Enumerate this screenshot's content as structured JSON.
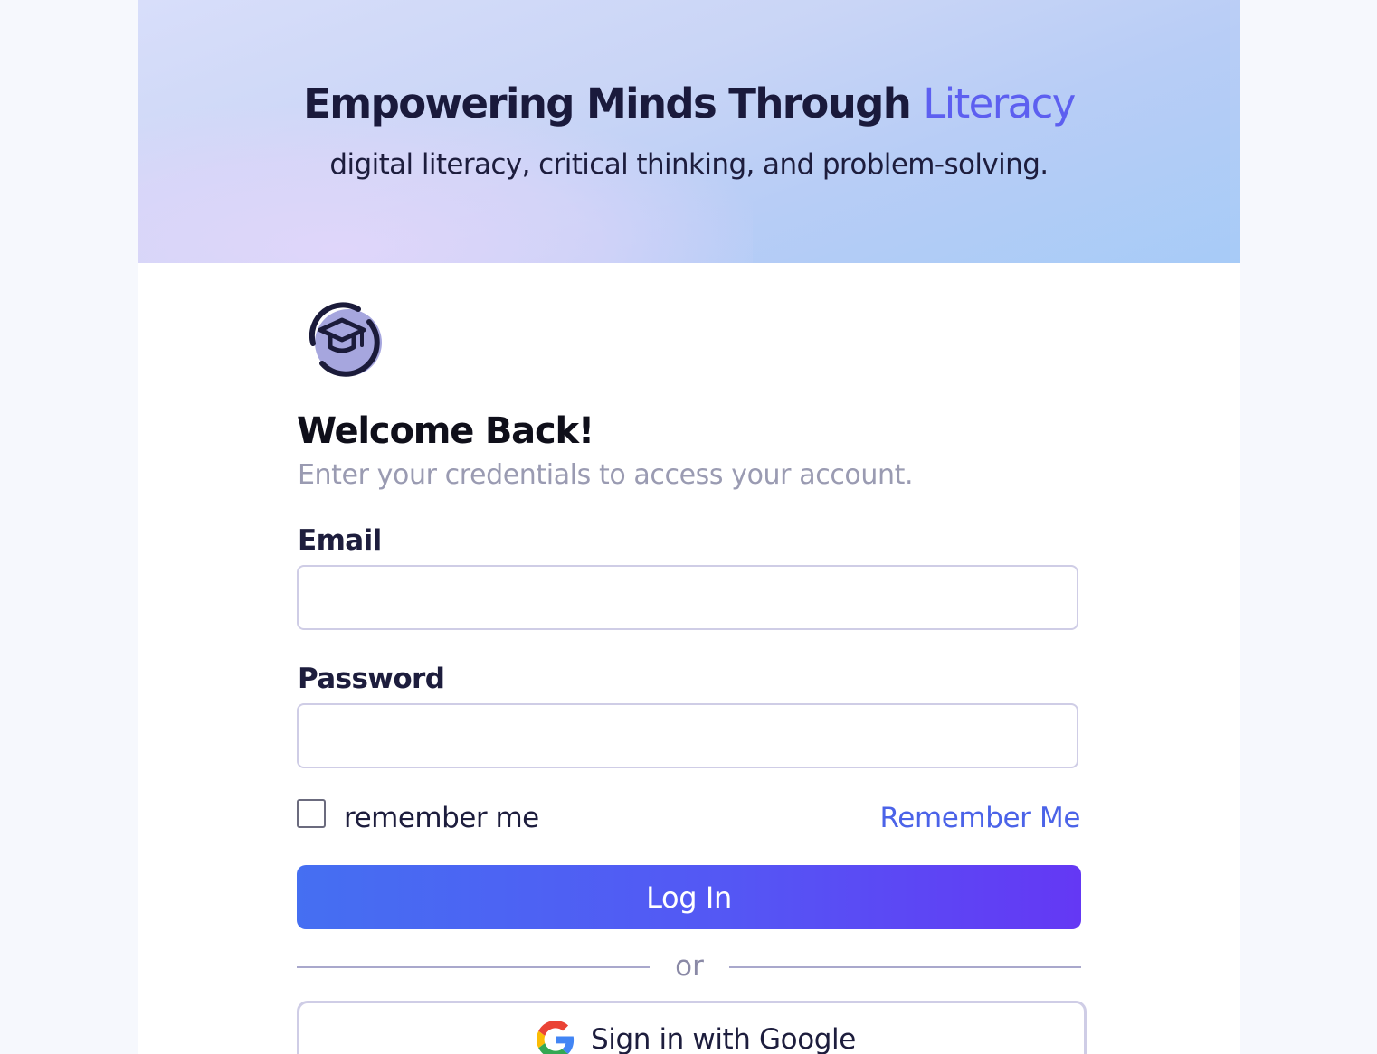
{
  "hero": {
    "title_main": "Empowering Minds Through ",
    "title_accent": "Literacy",
    "subtitle": "digital literacy, critical thinking, and problem-solving."
  },
  "logo": {
    "icon": "graduation-cap-logo-icon"
  },
  "form": {
    "heading": "Welcome Back!",
    "subheading": "Enter your credentials to access your account.",
    "email": {
      "label": "Email",
      "value": "",
      "placeholder": ""
    },
    "password": {
      "label": "Password",
      "value": "",
      "placeholder": ""
    },
    "remember": {
      "checkbox_label": "remember me",
      "checked": false,
      "link_label": "Remember Me"
    },
    "login_label": "Log In",
    "divider_label": "or",
    "google": {
      "label": "Sign in with Google",
      "icon": "google-icon"
    }
  },
  "colors": {
    "accent": "#5d5ff0",
    "link": "#4b63e8",
    "button_gradient_start": "#456ff2",
    "button_gradient_end": "#6438f4"
  }
}
